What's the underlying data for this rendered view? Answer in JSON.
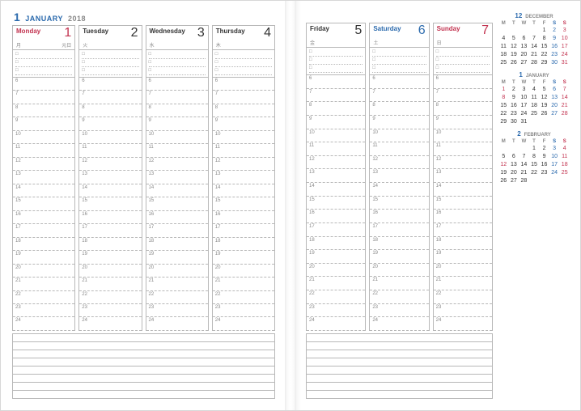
{
  "header": {
    "month_num": "1",
    "month_name": "JANUARY",
    "year": "2018"
  },
  "left_days": [
    {
      "name": "Monday",
      "num": "1",
      "jp": "月",
      "tick": "元日",
      "name_color": "#c2324f",
      "num_color": "#c2324f"
    },
    {
      "name": "Tuesday",
      "num": "2",
      "jp": "火",
      "tick": "",
      "name_color": "#333333",
      "num_color": "#333333"
    },
    {
      "name": "Wednesday",
      "num": "3",
      "jp": "水",
      "tick": "",
      "name_color": "#333333",
      "num_color": "#333333"
    },
    {
      "name": "Thursday",
      "num": "4",
      "jp": "木",
      "tick": "",
      "name_color": "#333333",
      "num_color": "#333333"
    }
  ],
  "right_days": [
    {
      "name": "Friday",
      "num": "5",
      "jp": "金",
      "tick": "",
      "name_color": "#333333",
      "num_color": "#333333"
    },
    {
      "name": "Saturday",
      "num": "6",
      "jp": "土",
      "tick": "",
      "name_color": "#2b6aad",
      "num_color": "#2b6aad"
    },
    {
      "name": "Sunday",
      "num": "7",
      "jp": "日",
      "tick": "",
      "name_color": "#c2324f",
      "num_color": "#c2324f"
    }
  ],
  "todo_bullet": "□",
  "todo_count": 3,
  "time_slots": [
    "6",
    "7",
    "8",
    "9",
    "10",
    "11",
    "12",
    "13",
    "14",
    "15",
    "16",
    "17",
    "18",
    "19",
    "20",
    "21",
    "22",
    "23",
    "24"
  ],
  "note_lines": 8,
  "mini_dow": [
    "M",
    "T",
    "W",
    "T",
    "F",
    "S",
    "S"
  ],
  "minis": [
    {
      "num": "12",
      "name": "DECEMBER",
      "cells": [
        {
          "t": "",
          "c": ""
        },
        {
          "t": "",
          "c": ""
        },
        {
          "t": "",
          "c": ""
        },
        {
          "t": "",
          "c": ""
        },
        {
          "t": "1",
          "c": ""
        },
        {
          "t": "2",
          "c": "c-blue"
        },
        {
          "t": "3",
          "c": "c-red"
        },
        {
          "t": "4",
          "c": ""
        },
        {
          "t": "5",
          "c": ""
        },
        {
          "t": "6",
          "c": ""
        },
        {
          "t": "7",
          "c": ""
        },
        {
          "t": "8",
          "c": ""
        },
        {
          "t": "9",
          "c": "c-blue"
        },
        {
          "t": "10",
          "c": "c-red"
        },
        {
          "t": "11",
          "c": ""
        },
        {
          "t": "12",
          "c": ""
        },
        {
          "t": "13",
          "c": ""
        },
        {
          "t": "14",
          "c": ""
        },
        {
          "t": "15",
          "c": ""
        },
        {
          "t": "16",
          "c": "c-blue"
        },
        {
          "t": "17",
          "c": "c-red"
        },
        {
          "t": "18",
          "c": ""
        },
        {
          "t": "19",
          "c": ""
        },
        {
          "t": "20",
          "c": ""
        },
        {
          "t": "21",
          "c": ""
        },
        {
          "t": "22",
          "c": ""
        },
        {
          "t": "23",
          "c": "c-blue"
        },
        {
          "t": "24",
          "c": "c-red"
        },
        {
          "t": "25",
          "c": ""
        },
        {
          "t": "26",
          "c": ""
        },
        {
          "t": "27",
          "c": ""
        },
        {
          "t": "28",
          "c": ""
        },
        {
          "t": "29",
          "c": ""
        },
        {
          "t": "30",
          "c": "c-blue"
        },
        {
          "t": "31",
          "c": "c-red"
        }
      ]
    },
    {
      "num": "1",
      "name": "JANUARY",
      "cells": [
        {
          "t": "1",
          "c": "c-red"
        },
        {
          "t": "2",
          "c": ""
        },
        {
          "t": "3",
          "c": ""
        },
        {
          "t": "4",
          "c": ""
        },
        {
          "t": "5",
          "c": ""
        },
        {
          "t": "6",
          "c": "c-blue"
        },
        {
          "t": "7",
          "c": "c-red"
        },
        {
          "t": "8",
          "c": "c-red"
        },
        {
          "t": "9",
          "c": ""
        },
        {
          "t": "10",
          "c": ""
        },
        {
          "t": "11",
          "c": ""
        },
        {
          "t": "12",
          "c": ""
        },
        {
          "t": "13",
          "c": "c-blue"
        },
        {
          "t": "14",
          "c": "c-red"
        },
        {
          "t": "15",
          "c": ""
        },
        {
          "t": "16",
          "c": ""
        },
        {
          "t": "17",
          "c": ""
        },
        {
          "t": "18",
          "c": ""
        },
        {
          "t": "19",
          "c": ""
        },
        {
          "t": "20",
          "c": "c-blue"
        },
        {
          "t": "21",
          "c": "c-red"
        },
        {
          "t": "22",
          "c": ""
        },
        {
          "t": "23",
          "c": ""
        },
        {
          "t": "24",
          "c": ""
        },
        {
          "t": "25",
          "c": ""
        },
        {
          "t": "26",
          "c": ""
        },
        {
          "t": "27",
          "c": "c-blue"
        },
        {
          "t": "28",
          "c": "c-red"
        },
        {
          "t": "29",
          "c": ""
        },
        {
          "t": "30",
          "c": ""
        },
        {
          "t": "31",
          "c": ""
        },
        {
          "t": "",
          "c": ""
        },
        {
          "t": "",
          "c": ""
        },
        {
          "t": "",
          "c": ""
        },
        {
          "t": "",
          "c": ""
        }
      ]
    },
    {
      "num": "2",
      "name": "FEBRUARY",
      "cells": [
        {
          "t": "",
          "c": ""
        },
        {
          "t": "",
          "c": ""
        },
        {
          "t": "",
          "c": ""
        },
        {
          "t": "1",
          "c": ""
        },
        {
          "t": "2",
          "c": ""
        },
        {
          "t": "3",
          "c": "c-blue"
        },
        {
          "t": "4",
          "c": "c-red"
        },
        {
          "t": "5",
          "c": ""
        },
        {
          "t": "6",
          "c": ""
        },
        {
          "t": "7",
          "c": ""
        },
        {
          "t": "8",
          "c": ""
        },
        {
          "t": "9",
          "c": ""
        },
        {
          "t": "10",
          "c": "c-blue"
        },
        {
          "t": "11",
          "c": "c-red"
        },
        {
          "t": "12",
          "c": "c-red"
        },
        {
          "t": "13",
          "c": ""
        },
        {
          "t": "14",
          "c": ""
        },
        {
          "t": "15",
          "c": ""
        },
        {
          "t": "16",
          "c": ""
        },
        {
          "t": "17",
          "c": "c-blue"
        },
        {
          "t": "18",
          "c": "c-red"
        },
        {
          "t": "19",
          "c": ""
        },
        {
          "t": "20",
          "c": ""
        },
        {
          "t": "21",
          "c": ""
        },
        {
          "t": "22",
          "c": ""
        },
        {
          "t": "23",
          "c": ""
        },
        {
          "t": "24",
          "c": "c-blue"
        },
        {
          "t": "25",
          "c": "c-red"
        },
        {
          "t": "26",
          "c": ""
        },
        {
          "t": "27",
          "c": ""
        },
        {
          "t": "28",
          "c": ""
        },
        {
          "t": "",
          "c": ""
        },
        {
          "t": "",
          "c": ""
        },
        {
          "t": "",
          "c": ""
        },
        {
          "t": "",
          "c": ""
        }
      ]
    }
  ]
}
